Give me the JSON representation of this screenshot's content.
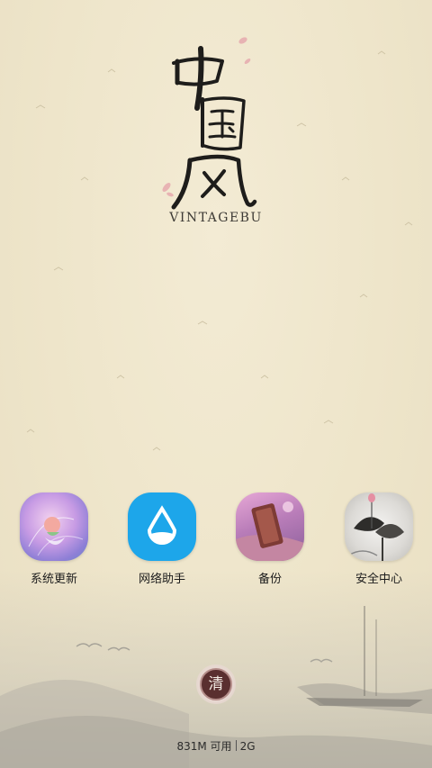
{
  "logo": {
    "chinese": "中国风",
    "brand": "VINTAGEBU"
  },
  "apps": [
    {
      "label": "系统更新",
      "icon": "system-update-icon"
    },
    {
      "label": "网络助手",
      "icon": "network-assistant-icon"
    },
    {
      "label": "备份",
      "icon": "backup-icon"
    },
    {
      "label": "安全中心",
      "icon": "security-center-icon"
    }
  ],
  "clean_button": {
    "label": "清"
  },
  "memory": {
    "available": "831M 可用",
    "total": "2G"
  },
  "colors": {
    "network_blue": "#1da6ea",
    "clean_button": "#5a2f2f"
  }
}
